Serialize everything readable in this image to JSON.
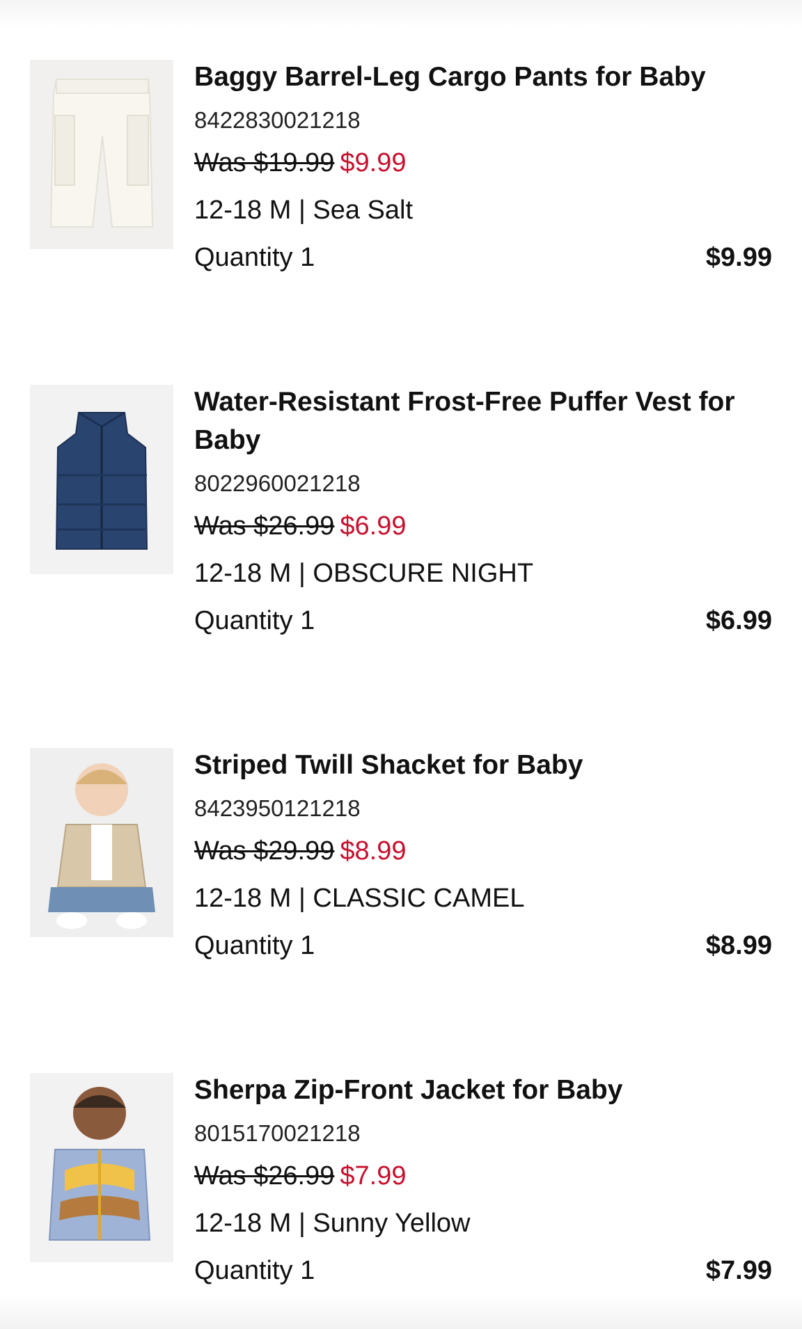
{
  "cart": {
    "items": [
      {
        "title": "Baggy Barrel-Leg Cargo Pants for Baby",
        "sku": "8422830021218",
        "was_price": "Was $19.99",
        "sale_price": "$9.99",
        "variant": "12-18 M | Sea Salt",
        "quantity": "Quantity 1",
        "line_total": "$9.99",
        "image_icon": "cargo-pants-image"
      },
      {
        "title": "Water-Resistant Frost-Free Puffer Vest for Baby",
        "sku": "8022960021218",
        "was_price": "Was $26.99",
        "sale_price": "$6.99",
        "variant": "12-18 M | OBSCURE NIGHT",
        "quantity": "Quantity 1",
        "line_total": "$6.99",
        "image_icon": "puffer-vest-image"
      },
      {
        "title": "Striped Twill Shacket for Baby",
        "sku": "8423950121218",
        "was_price": "Was $29.99",
        "sale_price": "$8.99",
        "variant": "12-18 M | CLASSIC CAMEL",
        "quantity": "Quantity 1",
        "line_total": "$8.99",
        "image_icon": "shacket-baby-image"
      },
      {
        "title": "Sherpa Zip-Front Jacket for Baby",
        "sku": "8015170021218",
        "was_price": "Was $26.99",
        "sale_price": "$7.99",
        "variant": "12-18 M | Sunny Yellow",
        "quantity": "Quantity 1",
        "line_total": "$7.99",
        "image_icon": "sherpa-jacket-image"
      }
    ]
  },
  "colors": {
    "sale_red": "#c8102e",
    "text": "#111111",
    "thumb_bg": "#f3f3f3"
  }
}
